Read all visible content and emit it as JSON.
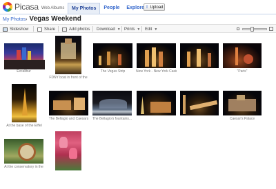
{
  "header": {
    "logo_text": "Picasa",
    "logo_sub": "Web Albums",
    "tabs": [
      {
        "label": "My Photos",
        "active": true
      },
      {
        "label": "People",
        "active": false
      },
      {
        "label": "Explore",
        "active": false
      }
    ],
    "upload_label": "Upload"
  },
  "breadcrumb": {
    "root": "My Photos",
    "separator": "›",
    "album": "Vegas Weekend"
  },
  "toolbar": {
    "slideshow": "Slideshow",
    "share": "Share",
    "add_photos": "Add photos",
    "download": "Download",
    "prints": "Prints",
    "edit": "Edit",
    "thumbnail_size": 0.38
  },
  "photos": [
    {
      "caption": "Excalibur",
      "palette": "dusk"
    },
    {
      "caption": "FDNY boat in front of the",
      "palette": "night"
    },
    {
      "caption": "The Vegas Strip",
      "palette": "night"
    },
    {
      "caption": "New York - New York Casino",
      "palette": "night"
    },
    {
      "caption": "",
      "palette": "night"
    },
    {
      "caption": "\"Paris\"",
      "palette": "night"
    },
    {
      "caption": "At the base of the Eiffel",
      "palette": "gold"
    },
    {
      "caption": "The Bellagio and Caesars",
      "palette": "night"
    },
    {
      "caption": "The Bellagio's fountains...",
      "palette": "fountain"
    },
    {
      "caption": "",
      "palette": "night"
    },
    {
      "caption": "",
      "palette": "night"
    },
    {
      "caption": "Caesar's Palace",
      "palette": "night"
    },
    {
      "caption": "At the conservatory in the",
      "palette": "garden"
    },
    {
      "caption": "",
      "palette": "tulips"
    }
  ],
  "colors": {
    "link": "#3366cc",
    "tab_active_bg": "#e8eef7",
    "rule": "#c3d1e8"
  },
  "icons": [
    "picasa-logo-icon",
    "upload-icon",
    "slideshow-icon",
    "share-icon",
    "add-photos-icon",
    "caret-down-icon",
    "small-thumbnail-icon",
    "large-thumbnail-icon"
  ]
}
